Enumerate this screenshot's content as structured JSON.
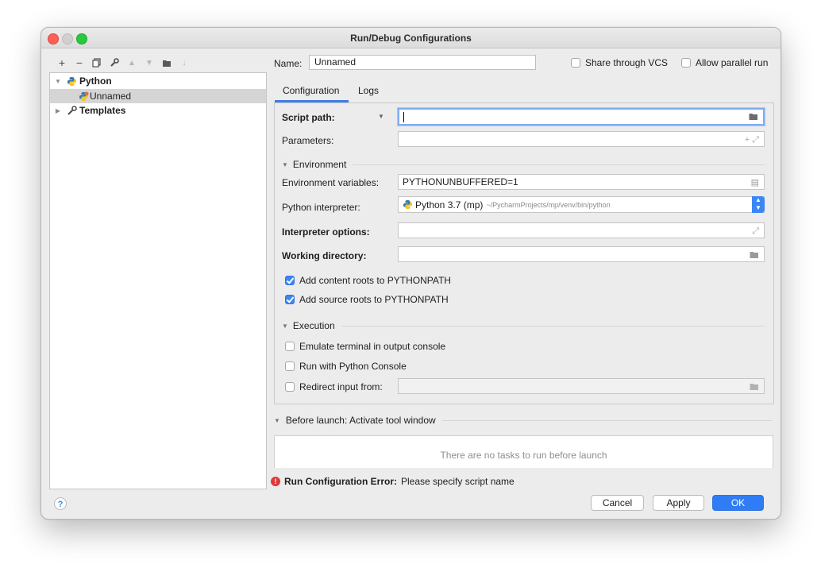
{
  "window": {
    "title": "Run/Debug Configurations"
  },
  "toolbar": {
    "add": "+",
    "remove": "−"
  },
  "tree": {
    "python": "Python",
    "unnamed": "Unnamed",
    "templates": "Templates"
  },
  "name": {
    "label": "Name:",
    "value": "Unnamed"
  },
  "share_vcs": "Share through VCS",
  "allow_parallel": "Allow parallel run",
  "tabs": {
    "configuration": "Configuration",
    "logs": "Logs"
  },
  "config": {
    "script_path_label": "Script path:",
    "parameters_label": "Parameters:",
    "environment_section": "Environment",
    "env_vars_label": "Environment variables:",
    "env_vars_value": "PYTHONUNBUFFERED=1",
    "interpreter_label": "Python interpreter:",
    "interpreter_value": "Python 3.7 (mp)",
    "interpreter_path": "~/PycharmProjects/mp/venv/bin/python",
    "interp_options_label": "Interpreter options:",
    "working_dir_label": "Working directory:",
    "add_content_roots": "Add content roots to PYTHONPATH",
    "add_source_roots": "Add source roots to PYTHONPATH",
    "execution_section": "Execution",
    "emulate_terminal": "Emulate terminal in output console",
    "run_with_console": "Run with Python Console",
    "redirect_input": "Redirect input from:"
  },
  "before_launch": {
    "header": "Before launch: Activate tool window",
    "empty": "There are no tasks to run before launch"
  },
  "error": {
    "prefix": "Run Configuration Error:",
    "message": "Please specify script name"
  },
  "buttons": {
    "help": "?",
    "cancel": "Cancel",
    "apply": "Apply",
    "ok": "OK"
  },
  "colors": {
    "accent": "#3b86f7",
    "error": "#db3b3b",
    "close": "#fe5f57",
    "zoom": "#28c940"
  }
}
